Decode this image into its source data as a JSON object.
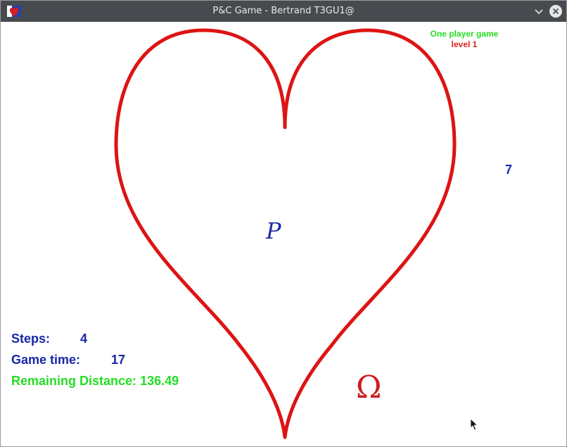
{
  "window": {
    "title": "P&C Game - Bertrand T3GU1@"
  },
  "header": {
    "mode": "One player game",
    "level": "level 1"
  },
  "board": {
    "number": "7",
    "point_label": "P",
    "goal_symbol": "Ω",
    "curve_color": "#dd1414"
  },
  "stats": {
    "steps_label": "Steps:",
    "steps_value": "4",
    "time_label": "Game time:",
    "time_value": "17",
    "distance_label": "Remaining Distance:",
    "distance_value": "136.49"
  },
  "icons": {
    "app": "heart-flag-icon",
    "minimize": "chevron-down-icon",
    "close": "close-icon",
    "cursor": "mouse-pointer-icon"
  }
}
